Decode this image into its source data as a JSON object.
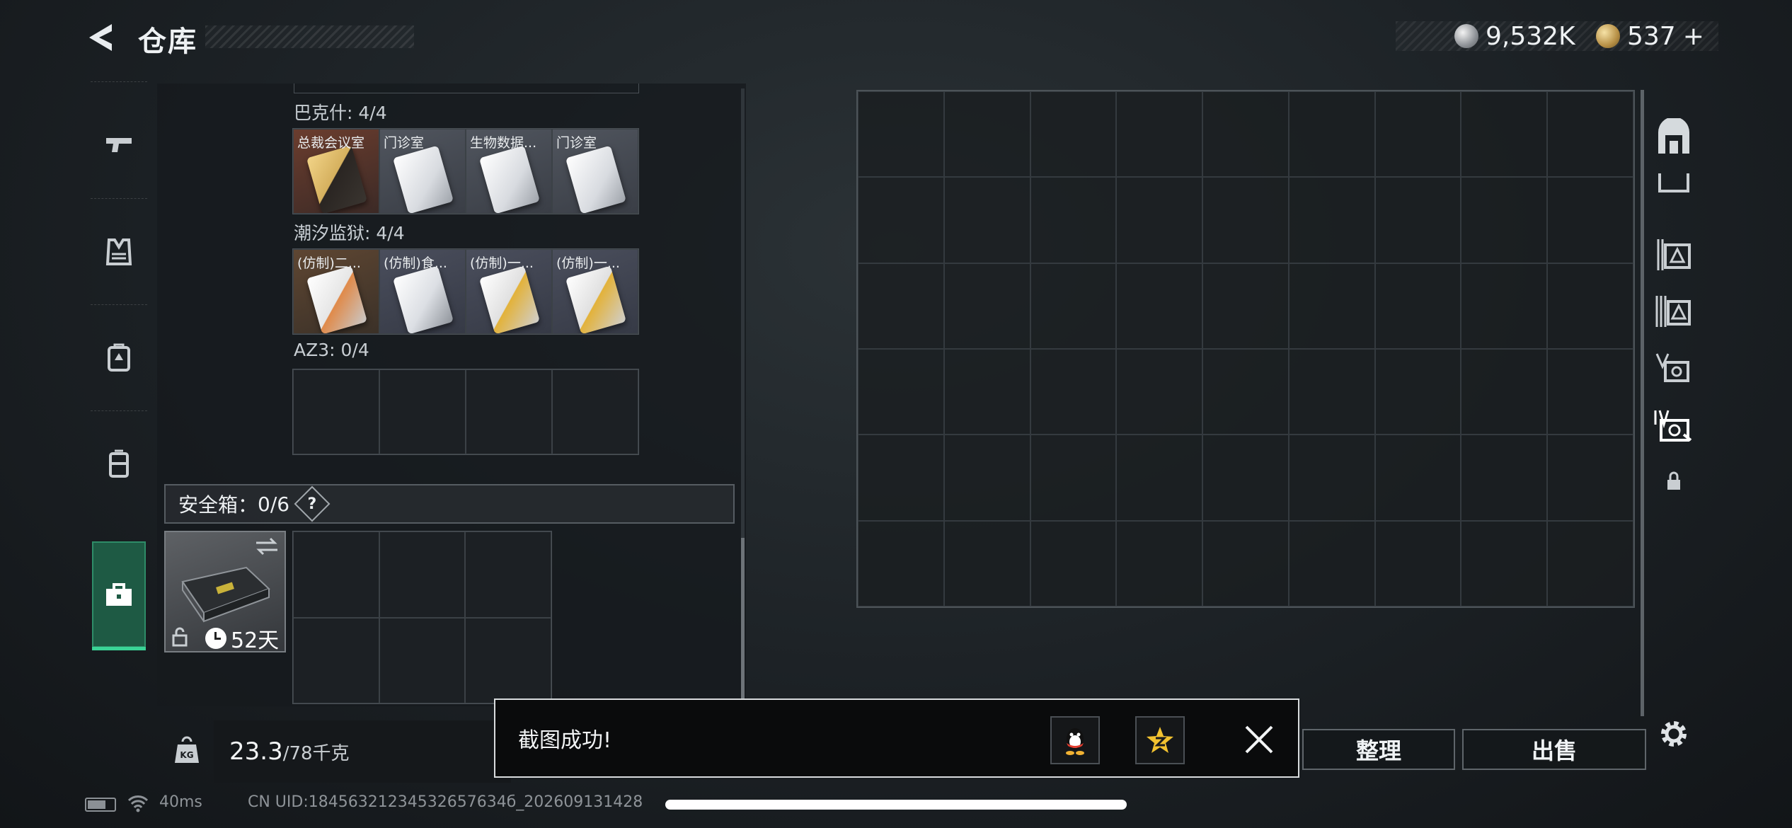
{
  "header": {
    "title": "仓库",
    "silver_amount": "9,532K",
    "gold_amount": "537",
    "add_symbol": "+"
  },
  "left_nav": {
    "items": [
      {
        "icon": "pistol-icon",
        "active": false
      },
      {
        "icon": "vest-icon",
        "active": false
      },
      {
        "icon": "backpack-icon",
        "active": false
      },
      {
        "icon": "chest-rig-icon",
        "active": false
      },
      {
        "icon": "toolbox-icon",
        "active": true
      }
    ]
  },
  "container": {
    "sections": [
      {
        "label": "巴克什: 4/4",
        "cards": [
          {
            "name": "总裁会议室",
            "style": "gold"
          },
          {
            "name": "门诊室",
            "style": "white"
          },
          {
            "name": "生物数据...",
            "style": "white"
          },
          {
            "name": "门诊室",
            "style": "white"
          }
        ]
      },
      {
        "label": "潮汐监狱: 4/4",
        "cards": [
          {
            "name": "(仿制)二...",
            "style": "gold"
          },
          {
            "name": "(仿制)食...",
            "style": "white"
          },
          {
            "name": "(仿制)一...",
            "style": "white"
          },
          {
            "name": "(仿制)一...",
            "style": "white"
          }
        ]
      },
      {
        "label": "AZ3: 0/4",
        "cards": []
      }
    ],
    "safe_box": {
      "label": "安全箱：",
      "count": "0/6",
      "help": "?",
      "days": "52天"
    }
  },
  "weight": {
    "current": "23.3",
    "max": "/78千克",
    "icon_text": "KG"
  },
  "buttons": {
    "organize": "整理",
    "sell": "出售"
  },
  "toast": {
    "message": "截图成功!"
  },
  "status_bar": {
    "ping": "40ms",
    "uid": "CN UID:18456321234532657634б_202609131428"
  },
  "colors": {
    "accent_green": "#3ad396",
    "active_tab_bg": "#1e5a44",
    "card_gold": "#6b3d2e",
    "card_white": "#454a55"
  }
}
